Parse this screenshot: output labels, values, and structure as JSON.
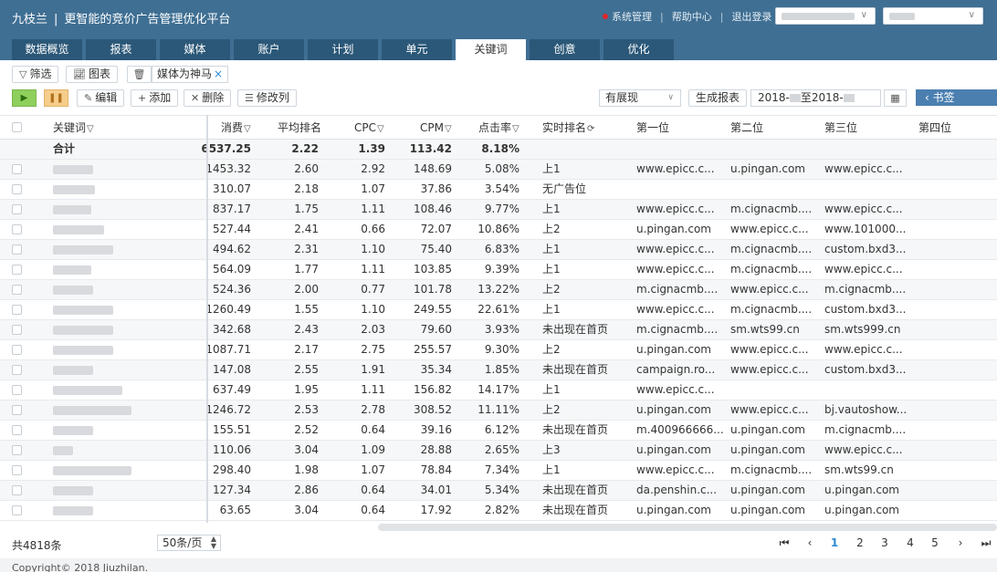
{
  "header": {
    "brand": "九枝兰",
    "separator": "|",
    "slogan": "更智能的竞价广告管理优化平台",
    "links": [
      "系统管理",
      "帮助中心",
      "退出登录"
    ],
    "link_separator": "|"
  },
  "tabs": [
    "数据概览",
    "报表",
    "媒体",
    "账户",
    "计划",
    "单元",
    "关键词",
    "创意",
    "优化"
  ],
  "active_tab": "关键词",
  "toolbar": {
    "filter_label": "筛选",
    "chart_label": "图表",
    "tag_label": "媒体为神马",
    "tag_remove": "×",
    "edit_label": "编辑",
    "add_label": "添加",
    "delete_label": "删除",
    "modify_columns_label": "修改列",
    "display_filter": "有展现",
    "generate_report_label": "生成报表",
    "date_start": "2018-",
    "date_mid": "至2018-",
    "bookmark_label": "书签"
  },
  "table": {
    "columns": [
      "关键词",
      "消费",
      "平均排名",
      "CPC",
      "CPM",
      "点击率",
      "实时排名",
      "第一位",
      "第二位",
      "第三位",
      "第四位"
    ],
    "filter_icon": "▽",
    "refresh_icon": "⟳",
    "total": {
      "keyword": "合计",
      "cost": "6537.25",
      "avg_rank": "2.22",
      "cpc": "1.39",
      "cpm": "113.42",
      "ctr": "8.18%"
    },
    "rows": [
      {
        "kw_w": 44,
        "cost": "1453.32",
        "avg": "2.60",
        "cpc": "2.92",
        "cpm": "148.69",
        "ctr": "5.08%",
        "rank": "上1",
        "p1": "www.epicc.c...",
        "p2": "u.pingan.com",
        "p3": "www.epicc.c..."
      },
      {
        "kw_w": 46,
        "cost": "310.07",
        "avg": "2.18",
        "cpc": "1.07",
        "cpm": "37.86",
        "ctr": "3.54%",
        "rank": "无广告位",
        "p1": "",
        "p2": "",
        "p3": ""
      },
      {
        "kw_w": 42,
        "cost": "837.17",
        "avg": "1.75",
        "cpc": "1.11",
        "cpm": "108.46",
        "ctr": "9.77%",
        "rank": "上1",
        "p1": "www.epicc.c...",
        "p2": "m.cignacmb....",
        "p3": "www.epicc.c..."
      },
      {
        "kw_w": 56,
        "cost": "527.44",
        "avg": "2.41",
        "cpc": "0.66",
        "cpm": "72.07",
        "ctr": "10.86%",
        "rank": "上2",
        "p1": "u.pingan.com",
        "p2": "www.epicc.c...",
        "p3": "www.101000..."
      },
      {
        "kw_w": 66,
        "cost": "494.62",
        "avg": "2.31",
        "cpc": "1.10",
        "cpm": "75.40",
        "ctr": "6.83%",
        "rank": "上1",
        "p1": "www.epicc.c...",
        "p2": "m.cignacmb....",
        "p3": "custom.bxd3..."
      },
      {
        "kw_w": 42,
        "cost": "564.09",
        "avg": "1.77",
        "cpc": "1.11",
        "cpm": "103.85",
        "ctr": "9.39%",
        "rank": "上1",
        "p1": "www.epicc.c...",
        "p2": "m.cignacmb....",
        "p3": "www.epicc.c..."
      },
      {
        "kw_w": 44,
        "cost": "524.36",
        "avg": "2.00",
        "cpc": "0.77",
        "cpm": "101.78",
        "ctr": "13.22%",
        "rank": "上2",
        "p1": "m.cignacmb....",
        "p2": "www.epicc.c...",
        "p3": "m.cignacmb...."
      },
      {
        "kw_w": 66,
        "cost": "1260.49",
        "avg": "1.55",
        "cpc": "1.10",
        "cpm": "249.55",
        "ctr": "22.61%",
        "rank": "上1",
        "p1": "www.epicc.c...",
        "p2": "m.cignacmb....",
        "p3": "custom.bxd3..."
      },
      {
        "kw_w": 66,
        "cost": "342.68",
        "avg": "2.43",
        "cpc": "2.03",
        "cpm": "79.60",
        "ctr": "3.93%",
        "rank": "未出现在首页",
        "p1": "m.cignacmb....",
        "p2": "sm.wts99.cn",
        "p3": "sm.wts999.cn"
      },
      {
        "kw_w": 66,
        "cost": "1087.71",
        "avg": "2.17",
        "cpc": "2.75",
        "cpm": "255.57",
        "ctr": "9.30%",
        "rank": "上2",
        "p1": "u.pingan.com",
        "p2": "www.epicc.c...",
        "p3": "www.epicc.c..."
      },
      {
        "kw_w": 44,
        "cost": "147.08",
        "avg": "2.55",
        "cpc": "1.91",
        "cpm": "35.34",
        "ctr": "1.85%",
        "rank": "未出现在首页",
        "p1": "campaign.ro...",
        "p2": "www.epicc.c...",
        "p3": "custom.bxd3..."
      },
      {
        "kw_w": 76,
        "cost": "637.49",
        "avg": "1.95",
        "cpc": "1.11",
        "cpm": "156.82",
        "ctr": "14.17%",
        "rank": "上1",
        "p1": "www.epicc.c...",
        "p2": "",
        "p3": ""
      },
      {
        "kw_w": 86,
        "cost": "1246.72",
        "avg": "2.53",
        "cpc": "2.78",
        "cpm": "308.52",
        "ctr": "11.11%",
        "rank": "上2",
        "p1": "u.pingan.com",
        "p2": "www.epicc.c...",
        "p3": "bj.vautoshow..."
      },
      {
        "kw_w": 44,
        "cost": "155.51",
        "avg": "2.52",
        "cpc": "0.64",
        "cpm": "39.16",
        "ctr": "6.12%",
        "rank": "未出现在首页",
        "p1": "m.400966666...",
        "p2": "u.pingan.com",
        "p3": "m.cignacmb...."
      },
      {
        "kw_w": 22,
        "cost": "110.06",
        "avg": "3.04",
        "cpc": "1.09",
        "cpm": "28.88",
        "ctr": "2.65%",
        "rank": "上3",
        "p1": "u.pingan.com",
        "p2": "u.pingan.com",
        "p3": "www.epicc.c..."
      },
      {
        "kw_w": 86,
        "cost": "298.40",
        "avg": "1.98",
        "cpc": "1.07",
        "cpm": "78.84",
        "ctr": "7.34%",
        "rank": "上1",
        "p1": "www.epicc.c...",
        "p2": "m.cignacmb....",
        "p3": "sm.wts99.cn"
      },
      {
        "kw_w": 44,
        "cost": "127.34",
        "avg": "2.86",
        "cpc": "0.64",
        "cpm": "34.01",
        "ctr": "5.34%",
        "rank": "未出现在首页",
        "p1": "da.penshin.c...",
        "p2": "u.pingan.com",
        "p3": "u.pingan.com"
      },
      {
        "kw_w": 44,
        "cost": "63.65",
        "avg": "3.04",
        "cpc": "0.64",
        "cpm": "17.92",
        "ctr": "2.82%",
        "rank": "未出现在首页",
        "p1": "u.pingan.com",
        "p2": "u.pingan.com",
        "p3": "u.pingan.com"
      }
    ]
  },
  "footer": {
    "total_count": "共4818条",
    "page_size": "50条/页",
    "pages": [
      "1",
      "2",
      "3",
      "4",
      "5"
    ],
    "active_page": "1",
    "copyright": "Copyright© 2018 Jiuzhilan."
  }
}
